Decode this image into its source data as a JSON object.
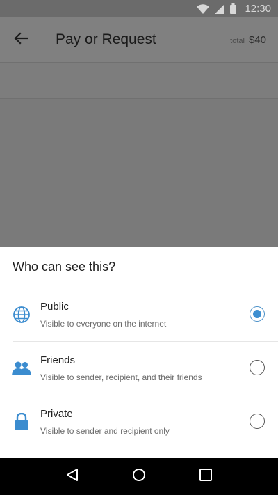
{
  "status_bar": {
    "time": "12:30"
  },
  "app_bar": {
    "title": "Pay or Request",
    "total_label": "total",
    "total_amount": "$40"
  },
  "sheet": {
    "title": "Who can see this?",
    "options": [
      {
        "label": "Public",
        "description": "Visible to everyone on the internet",
        "icon": "globe-icon",
        "selected": true
      },
      {
        "label": "Friends",
        "description": "Visible to sender, recipient, and their friends",
        "icon": "friends-icon",
        "selected": false
      },
      {
        "label": "Private",
        "description": "Visible to sender and recipient only",
        "icon": "lock-icon",
        "selected": false
      }
    ]
  },
  "colors": {
    "accent": "#3d8fd1",
    "icon": "#3b8ccf"
  }
}
